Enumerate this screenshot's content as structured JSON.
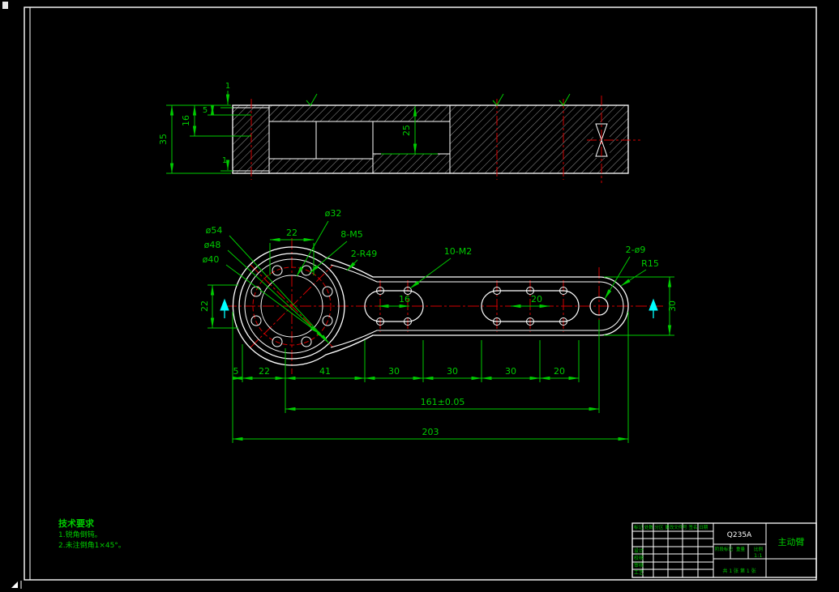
{
  "colors": {
    "background": "#000000",
    "outline": "#ffffff",
    "dimension_green": "#00cc00",
    "centerline_red": "#d40000",
    "accent_cyan": "#00ffff"
  },
  "section_view": {
    "dims": {
      "top1": "1",
      "d5": "5",
      "d16": "16",
      "d35": "35",
      "bottom1": "1",
      "d25": "25"
    }
  },
  "plan_view": {
    "labels": {
      "d54": "ø54",
      "d48": "ø48",
      "d40": "ø40",
      "d32": "ø32",
      "m5": "8-M5",
      "r49": "2-R49",
      "m2": "10-M2",
      "d9": "2-ø9",
      "r15": "R15"
    },
    "dims": {
      "top22": "22",
      "left22": "22",
      "right30": "30",
      "slot16": "16",
      "slot20": "20"
    }
  },
  "dim_chain": {
    "segments": [
      "5",
      "22",
      "41",
      "30",
      "30",
      "30",
      "20"
    ],
    "total_mid": "161±0.05",
    "total": "203"
  },
  "tech_req": {
    "title": "技术要求",
    "lines": [
      "1.锐角倒钝。",
      "2.未注倒角1×45°。"
    ]
  },
  "title_block": {
    "material": "Q235A",
    "part_name": "主动臂",
    "header_row": "标记 处数 分区 更改文件号 签名 日期",
    "rows": [
      "设计",
      "校核",
      "审核",
      "工艺"
    ],
    "stage_label": "阶段标记",
    "weight_label": "重量",
    "scale_label": "比例",
    "scale_value": "1:1",
    "sheet": "共 1 张 第 1 张"
  }
}
